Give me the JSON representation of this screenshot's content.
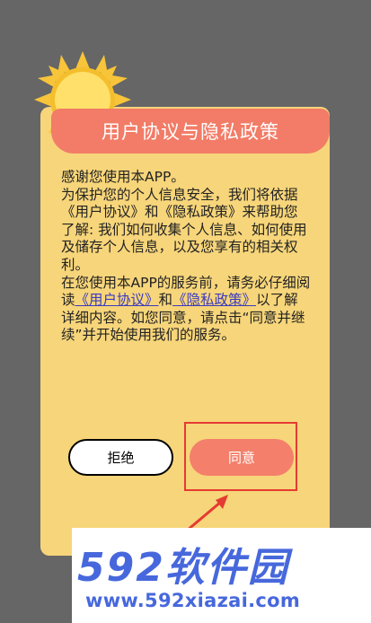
{
  "dialog": {
    "title": "用户协议与隐私政策",
    "greeting": "感谢您使用本APP。",
    "paragraph1": "为保护您的个人信息安全，我们将依据《用户协议》和《隐私政策》来帮助您了解: 我们如何收集个人信息、如何使用及储存个人信息，以及您享有的相关权利。",
    "paragraph2_prefix": "在您使用本APP的服务前，请务必仔细阅读",
    "user_agreement_link": "《用户协议》",
    "and_text": "和",
    "privacy_policy_link": "《隐私政策》",
    "paragraph2_suffix": "以了解详细内容。如您同意，请点击“同意并继续”并开始使用我们的服务。",
    "reject_label": "拒绝",
    "agree_label": "同意"
  },
  "watermark": {
    "logo_text": "592软件园",
    "url": "www.592xiazai.com"
  },
  "colors": {
    "background": "#666666",
    "card": "#F7D57A",
    "title_bar": "#F27C67",
    "agree_button": "#F47F6B",
    "link": "#3B3BC0",
    "highlight": "#E53A32",
    "watermark": "#4768DC"
  }
}
